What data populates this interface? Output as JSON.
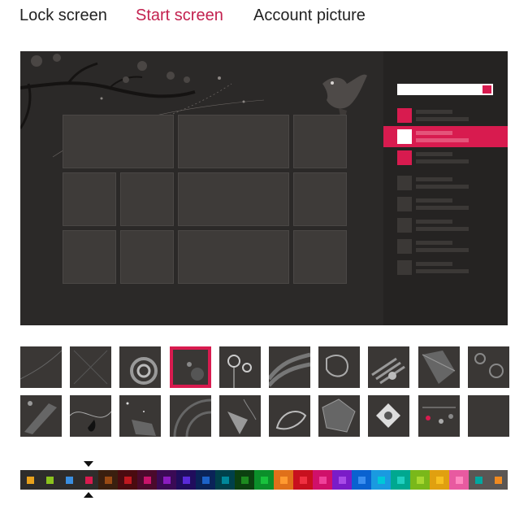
{
  "tabs": [
    {
      "label": "Lock screen"
    },
    {
      "label": "Start screen"
    },
    {
      "label": "Account picture"
    }
  ],
  "active_tab": "Start screen",
  "accent_color": "#d81b4f",
  "background_color": "#2b2928",
  "selected_pattern_index": 3,
  "selected_color_index": 3,
  "patterns": [
    {
      "name": "pattern-1-icon"
    },
    {
      "name": "pattern-2-icon"
    },
    {
      "name": "pattern-3-icon"
    },
    {
      "name": "pattern-4-icon"
    },
    {
      "name": "pattern-5-icon"
    },
    {
      "name": "pattern-6-icon"
    },
    {
      "name": "pattern-7-icon"
    },
    {
      "name": "pattern-8-icon"
    },
    {
      "name": "pattern-9-icon"
    },
    {
      "name": "pattern-10-icon"
    },
    {
      "name": "pattern-11-icon"
    },
    {
      "name": "pattern-12-icon"
    },
    {
      "name": "pattern-13-icon"
    },
    {
      "name": "pattern-14-icon"
    },
    {
      "name": "pattern-15-icon"
    },
    {
      "name": "pattern-16-icon"
    },
    {
      "name": "pattern-17-icon"
    },
    {
      "name": "pattern-18-icon"
    },
    {
      "name": "pattern-19-icon"
    },
    {
      "name": "pattern-20-icon"
    }
  ],
  "color_swatches": [
    {
      "bg": "#2e2c2b",
      "dot": "#e8a11c"
    },
    {
      "bg": "#2e2c2b",
      "dot": "#8bc21e"
    },
    {
      "bg": "#2e2c2b",
      "dot": "#3a8ee0"
    },
    {
      "bg": "#2e2c2b",
      "dot": "#d81b4f"
    },
    {
      "bg": "#3a1f0f",
      "dot": "#9a4a14"
    },
    {
      "bg": "#4a0b10",
      "dot": "#c01820"
    },
    {
      "bg": "#4a0a2c",
      "dot": "#c8146a"
    },
    {
      "bg": "#3a0a55",
      "dot": "#8a1cc0"
    },
    {
      "bg": "#200d5c",
      "dot": "#5a2ad8"
    },
    {
      "bg": "#0a2358",
      "dot": "#1c62c8"
    },
    {
      "bg": "#00404a",
      "dot": "#00889a"
    },
    {
      "bg": "#0c4010",
      "dot": "#1d8a1f"
    },
    {
      "bg": "#0b8f2a",
      "dot": "#18c23c"
    },
    {
      "bg": "#e0701a",
      "dot": "#ff9a30"
    },
    {
      "bg": "#c8101e",
      "dot": "#f03040"
    },
    {
      "bg": "#d0106a",
      "dot": "#f0409a"
    },
    {
      "bg": "#7a1cc8",
      "dot": "#a84ae8"
    },
    {
      "bg": "#0a62d0",
      "dot": "#3a8ef0"
    },
    {
      "bg": "#1a9ae0",
      "dot": "#00c8d8"
    },
    {
      "bg": "#00a890",
      "dot": "#20d0c0"
    },
    {
      "bg": "#7ab81a",
      "dot": "#a8d830"
    },
    {
      "bg": "#e0a010",
      "dot": "#f8c020"
    },
    {
      "bg": "#e85aa0",
      "dot": "#ff88c0"
    },
    {
      "bg": "#5a5654",
      "dot": "#00a8a0"
    },
    {
      "bg": "#5a5654",
      "dot": "#f08a20"
    }
  ]
}
